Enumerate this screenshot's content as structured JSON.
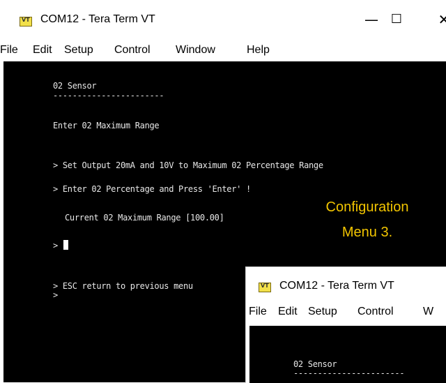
{
  "main_window": {
    "title": "COM12 - Tera Term VT",
    "icon_text": "VT",
    "controls": {
      "minimize": "—",
      "maximize": "☐",
      "close": "✕"
    },
    "menu": [
      "File",
      "Edit",
      "Setup",
      "Control",
      "Window",
      "Help"
    ],
    "terminal_lines": [
      "02 Sensor",
      "-----------------------",
      "Enter 02 Maximum Range",
      "> Set Output 20mA and 10V to Maximum 02 Percentage Range",
      "> Enter 02 Percentage and Press 'Enter' !",
      "Current 02 Maximum Range [100.00]",
      ">",
      "> ESC return to previous menu",
      ">"
    ]
  },
  "annotation": {
    "line1": "Configuration",
    "line2": "Menu 3."
  },
  "second_window": {
    "title": "COM12 - Tera Term VT",
    "icon_text": "VT",
    "menu": [
      "File",
      "Edit",
      "Setup",
      "Control",
      "W"
    ],
    "terminal_lines": [
      "02 Sensor",
      "-----------------------"
    ]
  }
}
